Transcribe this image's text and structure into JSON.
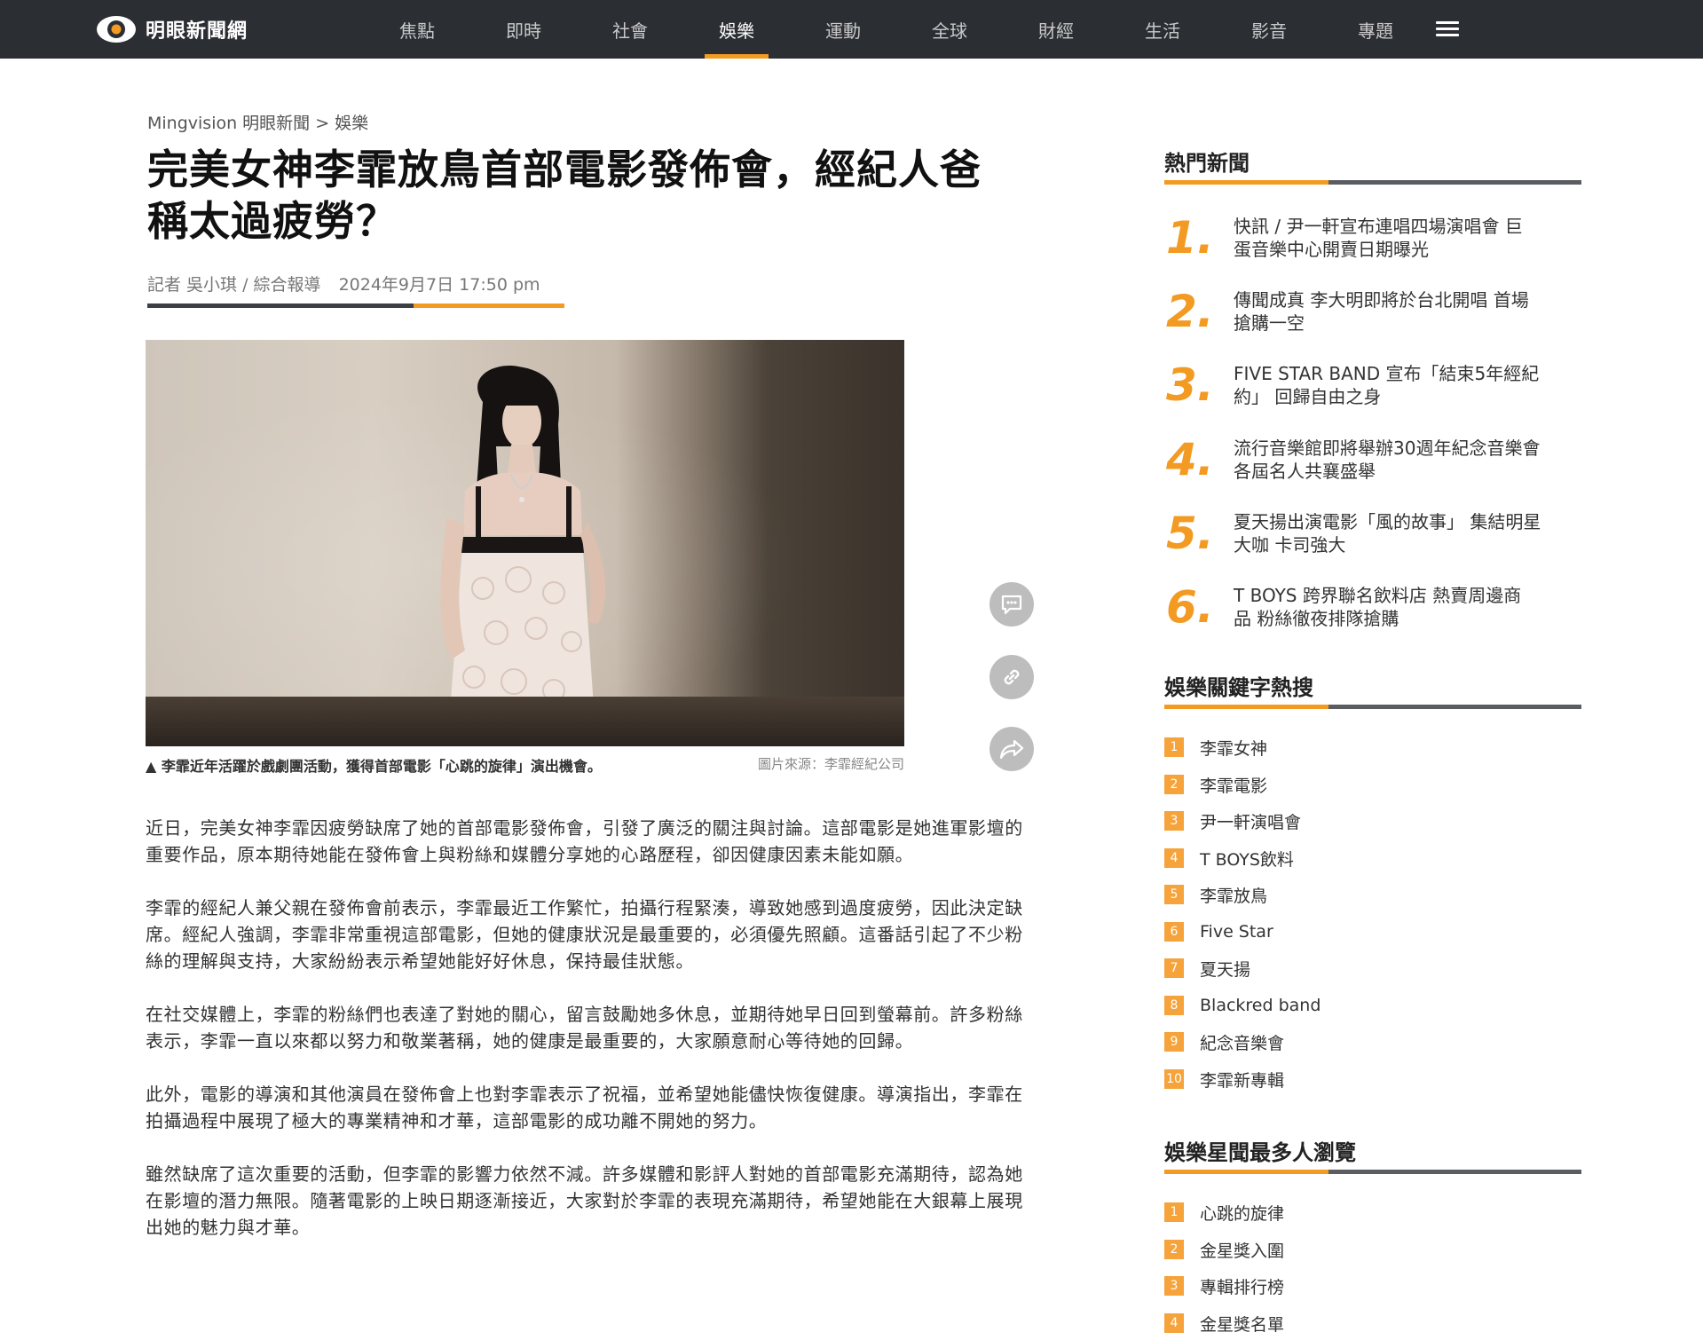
{
  "site": {
    "name": "明眼新聞網"
  },
  "nav": {
    "items": [
      "焦點",
      "即時",
      "社會",
      "娛樂",
      "運動",
      "全球",
      "財經",
      "生活",
      "影音",
      "專題"
    ],
    "active": "娛樂"
  },
  "article": {
    "breadcrumb": "Mingvision 明眼新聞 > 娛樂",
    "title_line1": "完美女神李霏放鳥首部電影發佈會，經紀人爸",
    "title_line2": "稱太過疲勞？",
    "reporter": "記者 吳小琪 / 綜合報導",
    "date": "2024年9月7日 17:50 pm",
    "caption": "▲ 李霏近年活躍於戲劇團活動，獲得首部電影「心跳的旋律」演出機會。",
    "photo_source": "圖片來源：李霏經紀公司",
    "paragraphs": [
      "近日，完美女神李霏因疲勞缺席了她的首部電影發佈會，引發了廣泛的關注與討論。這部電影是她進軍影壇的重要作品，原本期待她能在發佈會上與粉絲和媒體分享她的心路歷程，卻因健康因素未能如願。",
      "李霏的經紀人兼父親在發佈會前表示，李霏最近工作繁忙，拍攝行程緊湊，導致她感到過度疲勞，因此決定缺席。經紀人強調，李霏非常重視這部電影，但她的健康狀況是最重要的，必須優先照顧。這番話引起了不少粉絲的理解與支持，大家紛紛表示希望她能好好休息，保持最佳狀態。",
      "在社交媒體上，李霏的粉絲們也表達了對她的關心，留言鼓勵她多休息，並期待她早日回到螢幕前。許多粉絲表示，李霏一直以來都以努力和敬業著稱，她的健康是最重要的，大家願意耐心等待她的回歸。",
      "此外，電影的導演和其他演員在發佈會上也對李霏表示了祝福，並希望她能儘快恢復健康。導演指出，李霏在拍攝過程中展現了極大的專業精神和才華，這部電影的成功離不開她的努力。",
      "雖然缺席了這次重要的活動，但李霏的影響力依然不減。許多媒體和影評人對她的首部電影充滿期待，認為她在影壇的潛力無限。隨著電影的上映日期逐漸接近，大家對於李霏的表現充滿期待，希望她能在大銀幕上展現出她的魅力與才華。"
    ]
  },
  "share_icons": [
    "comment-icon",
    "link-icon",
    "share-icon"
  ],
  "sidebar": {
    "hot_title": "熱門新聞",
    "hot": [
      {
        "num": "1.",
        "line1": "快訊 / 尹一軒宣布連唱四場演唱會 巨",
        "line2": "蛋音樂中心開賣日期曝光"
      },
      {
        "num": "2.",
        "line1": "傳聞成真 李大明即將於台北開唱 首場",
        "line2": "搶購一空"
      },
      {
        "num": "3.",
        "line1": "FIVE STAR BAND 宣布「結束5年經紀",
        "line2": "約」 回歸自由之身"
      },
      {
        "num": "4.",
        "line1": "流行音樂館即將舉辦30週年紀念音樂會",
        "line2": "各屆名人共襄盛舉"
      },
      {
        "num": "5.",
        "line1": "夏天揚出演電影「風的故事」 集結明星",
        "line2": "大咖 卡司強大"
      },
      {
        "num": "6.",
        "line1": "T BOYS 跨界聯名飲料店 熱賣周邊商",
        "line2": "品 粉絲徹夜排隊搶購"
      }
    ],
    "kw_title": "娛樂關鍵字熱搜",
    "keywords": [
      "李霏女神",
      "李霏電影",
      "尹一軒演唱會",
      "T BOYS飲料",
      "李霏放鳥",
      "Five Star",
      "夏天揚",
      "Blackred band",
      "紀念音樂會",
      "李霏新專輯"
    ],
    "kw_nums": [
      "1",
      "2",
      "3",
      "4",
      "5",
      "6",
      "7",
      "8",
      "9",
      "10"
    ],
    "most_title": "娛樂星聞最多人瀏覽",
    "most": [
      "心跳的旋律",
      "金星獎入圍",
      "專輯排行榜",
      "金星獎名單"
    ],
    "most_nums": [
      "1",
      "2",
      "3",
      "4"
    ]
  },
  "colors": {
    "accent": "#f39a22",
    "topbar": "#2b2e33"
  }
}
